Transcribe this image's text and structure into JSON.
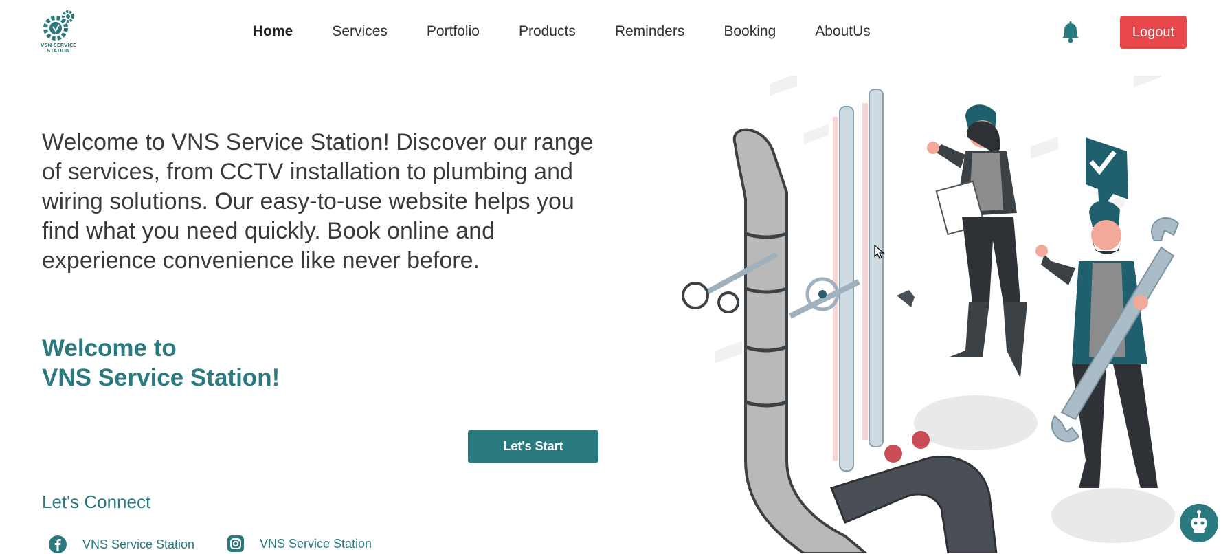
{
  "logo": {
    "text_line1": "VSN SERVICE",
    "text_line2": "STATION"
  },
  "nav": {
    "items": [
      {
        "label": "Home",
        "active": true
      },
      {
        "label": "Services"
      },
      {
        "label": "Portfolio"
      },
      {
        "label": "Products"
      },
      {
        "label": "Reminders"
      },
      {
        "label": "Booking"
      },
      {
        "label": "AboutUs"
      }
    ],
    "logout_label": "Logout"
  },
  "hero": {
    "intro": "Welcome to VNS Service Station! Discover our range of services, from CCTV installation to plumbing and wiring solutions. Our easy-to-use website helps you find what you need quickly. Book online and experience convenience like never before.",
    "welcome_line1": "Welcome to",
    "welcome_line2": "VNS Service Station!",
    "start_label": "Let's Start"
  },
  "connect": {
    "heading": "Let's Connect",
    "facebook_label": "VNS Service Station",
    "instagram_label": "VNS Service Station"
  },
  "icons": [
    "gear-logo-icon",
    "bell-icon",
    "facebook-icon",
    "instagram-icon",
    "chatbot-icon",
    "check-bubble-icon"
  ],
  "colors": {
    "brand_teal": "#2a7a80",
    "logout_red": "#e8474c",
    "text_dark": "#3a3a3a"
  }
}
